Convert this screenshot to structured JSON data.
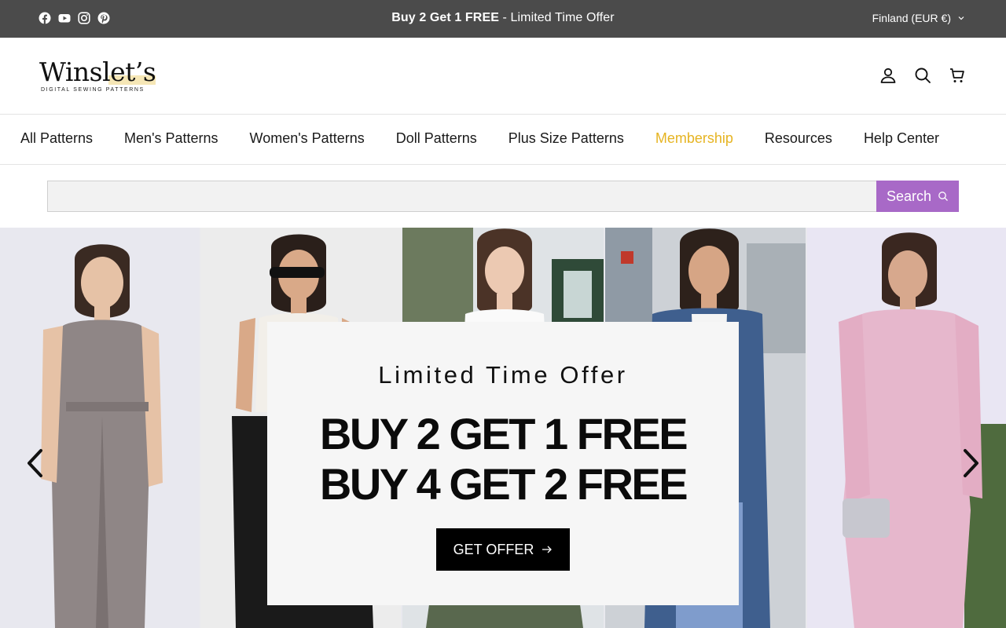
{
  "announcement": {
    "promo_bold": "Buy 2 Get 1 FREE",
    "promo_rest": " - Limited Time Offer",
    "country": "Finland (EUR €)",
    "social_icons": [
      "facebook-icon",
      "youtube-icon",
      "instagram-icon",
      "pinterest-icon"
    ],
    "background": "#4b4b4b"
  },
  "header": {
    "logo_word": "Winslet’s",
    "logo_tagline": "DIGITAL SEWING PATTERNS",
    "icons": [
      "account-icon",
      "search-icon",
      "cart-icon"
    ]
  },
  "nav": {
    "items": [
      {
        "label": "All Patterns"
      },
      {
        "label": "Men's Patterns"
      },
      {
        "label": "Women's Patterns"
      },
      {
        "label": "Doll Patterns"
      },
      {
        "label": "Plus Size Patterns"
      },
      {
        "label": "Membership"
      },
      {
        "label": "Resources"
      },
      {
        "label": "Help Center"
      }
    ],
    "accent_color": "#e6b422"
  },
  "search": {
    "value": "",
    "button_label": "Search",
    "button_color": "#a869c7"
  },
  "hero": {
    "kicker": "Limited Time Offer",
    "line1": "BUY 2 GET 1 FREE",
    "line2": "BUY 4 GET 2 FREE",
    "cta_label": "GET OFFER"
  }
}
